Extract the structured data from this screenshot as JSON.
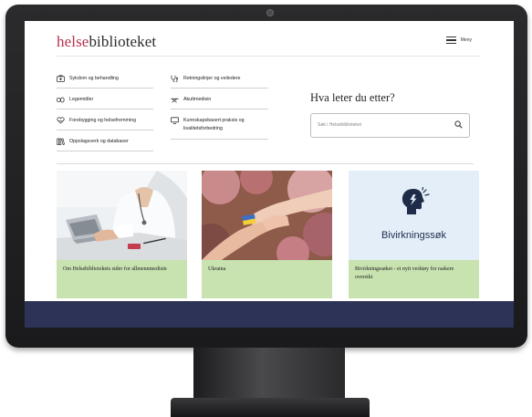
{
  "header": {
    "logo_part1": "helse",
    "logo_part2": "biblioteket",
    "menu_label": "Meny"
  },
  "nav": {
    "col1": [
      {
        "label": "Sykdom og behandling",
        "icon": "medical-case-icon"
      },
      {
        "label": "Legemidler",
        "icon": "pills-icon"
      },
      {
        "label": "Forebygging og helsefremming",
        "icon": "heart-hands-icon"
      },
      {
        "label": "Oppslagsverk og databaser",
        "icon": "books-icon"
      }
    ],
    "col2": [
      {
        "label": "Retningslinjer og veiledere",
        "icon": "stethoscope-icon"
      },
      {
        "label": "Akuttmedisin",
        "icon": "stretcher-icon"
      },
      {
        "label": "Kunnskapsbasert praksis og",
        "label2": "kvalitetsforbedring",
        "icon": "monitor-icon"
      }
    ]
  },
  "search": {
    "title": "Hva leter du etter?",
    "placeholder": "Søk i Helsebiblioteket"
  },
  "cards": [
    {
      "caption": "Om Helsebibliotekets sider for allmennmedisin",
      "image": "doctor-at-laptop-photo"
    },
    {
      "caption": "Ukraina",
      "image": "hands-ukraine-flag-photo"
    },
    {
      "caption": "Bivirkningssøket - et nytt verktøy for raskere oversikt",
      "label": "Bivirkningssøk",
      "icon": "head-alert-icon"
    }
  ],
  "colors": {
    "brand_red": "#b5304a",
    "card_green": "#c8e2b0",
    "footer_navy": "#2c3356",
    "bivirk_bg": "#e4eef9"
  }
}
